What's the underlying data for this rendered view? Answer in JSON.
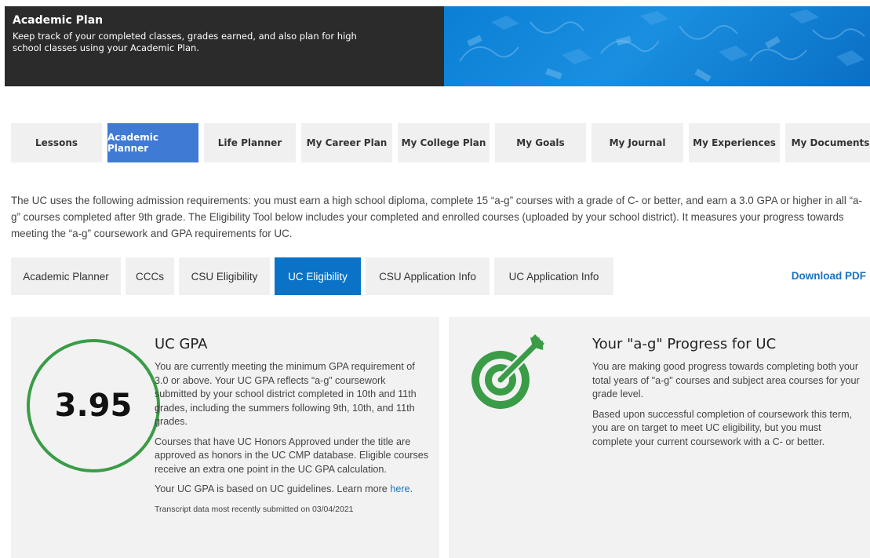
{
  "hero": {
    "title": "Academic Plan",
    "description": "Keep track of your completed classes, grades earned, and also plan for high school classes using your Academic Plan."
  },
  "main_tabs": [
    {
      "label": "Lessons"
    },
    {
      "label": "Academic Planner"
    },
    {
      "label": "Life Planner"
    },
    {
      "label": "My Career Plan"
    },
    {
      "label": "My College Plan"
    },
    {
      "label": "My Goals"
    },
    {
      "label": "My Journal"
    },
    {
      "label": "My Experiences"
    },
    {
      "label": "My Documents"
    }
  ],
  "intro": "The UC uses the following admission requirements: you must earn a high school diploma, complete 15 “a-g” courses with a grade of C- or better, and earn a 3.0 GPA or higher in all “a-g” courses completed after 9th grade. The Eligibility Tool below includes your completed and enrolled courses (uploaded by your school district). It measures your progress towards meeting the “a-g” coursework and GPA requirements for UC.",
  "sub_tabs": [
    {
      "label": "Academic Planner"
    },
    {
      "label": "CCCs"
    },
    {
      "label": "CSU Eligibility"
    },
    {
      "label": "UC Eligibility"
    },
    {
      "label": "CSU Application Info"
    },
    {
      "label": "UC Application Info"
    }
  ],
  "download_label": "Download PDF",
  "gpa_card": {
    "value": "3.95",
    "title": "UC GPA",
    "p1": "You are currently meeting the minimum GPA requirement of 3.0 or above. Your UC GPA reflects “a-g” coursework submitted by your school district completed in 10th and 11th grades, including the summers following 9th, 10th, and 11th grades.",
    "p2": "Courses that have UC Honors Approved under the title are approved as honors in the UC CMP database. Eligible courses receive an extra one point in the UC GPA calculation.",
    "p3_text": "Your UC GPA is based on UC guidelines. Learn more ",
    "p3_link": "here",
    "p3_end": ".",
    "note": "Transcript data most recently submitted on 03/04/2021",
    "ring_color": "#3a9c47"
  },
  "progress_card": {
    "title": "Your \"a-g\" Progress for UC",
    "p1": "You are making good progress towards completing both your total years of \"a-g\" courses and subject area courses for your grade level.",
    "p2": "Based upon successful completion of coursework this term, you are on target to meet UC eligibility, but you must complete your current coursework with a C- or better.",
    "icon": "target-arrow-icon",
    "icon_color": "#3a9c47"
  }
}
